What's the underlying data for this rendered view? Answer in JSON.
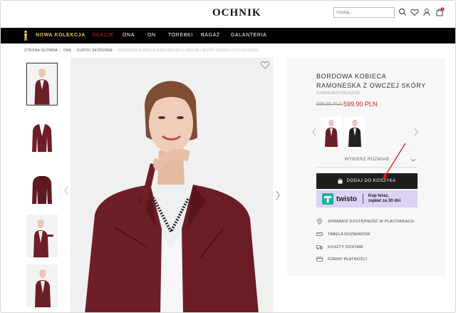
{
  "header": {
    "logo": "OCHNIK",
    "search_placeholder": "Szukaj...",
    "cart_count": "0"
  },
  "nav": {
    "items": [
      "NOWA KOLEKCJA",
      "OKAZJE",
      "ONA",
      "ON",
      "TOREBKI",
      "BAGAŻ",
      "GALANTERIA"
    ]
  },
  "breadcrumb": {
    "items": [
      "STRONA GŁÓWNA",
      "ONA",
      "KURTKI SKÓRZANE",
      "BORDOWA KOBIECA RAMONESKA Z OWCZEJ SKÓRY KURDS-0073-5613(Z20)"
    ]
  },
  "product": {
    "title": "BORDOWA KOBIECA RAMONESKA Z OWCZEJ SKÓRY",
    "sku": "KURDS-0073-5613(Z20)",
    "old_price": "999.90 PLN",
    "price": "599.90 PLN",
    "size_select": "WYBIERZ ROZMIAR",
    "add_to_cart": "DODAJ DO KOSZYKA",
    "twisto_name": "twisto",
    "twisto_line1": "Kup teraz,",
    "twisto_line2": "zapłać za 30 dni",
    "info": [
      {
        "icon": "location-icon",
        "label": "SPRAWDŹ DOSTĘPNOŚĆ W PLACÓWKACH"
      },
      {
        "icon": "ruler-icon",
        "label": "TABELA ROZMIARÓW"
      },
      {
        "icon": "truck-icon",
        "label": "KOSZTY DOSTAW"
      },
      {
        "icon": "card-icon",
        "label": "FORMY PŁATNOŚCI"
      }
    ]
  },
  "colors": {
    "jacket": "#6e1e26",
    "price_red": "#d0202a",
    "nav_bg": "#000000",
    "nowa_kolekcja": "#e8c85a",
    "twisto_bg": "#ddd1f4",
    "twisto_logo": "#16b69a"
  }
}
